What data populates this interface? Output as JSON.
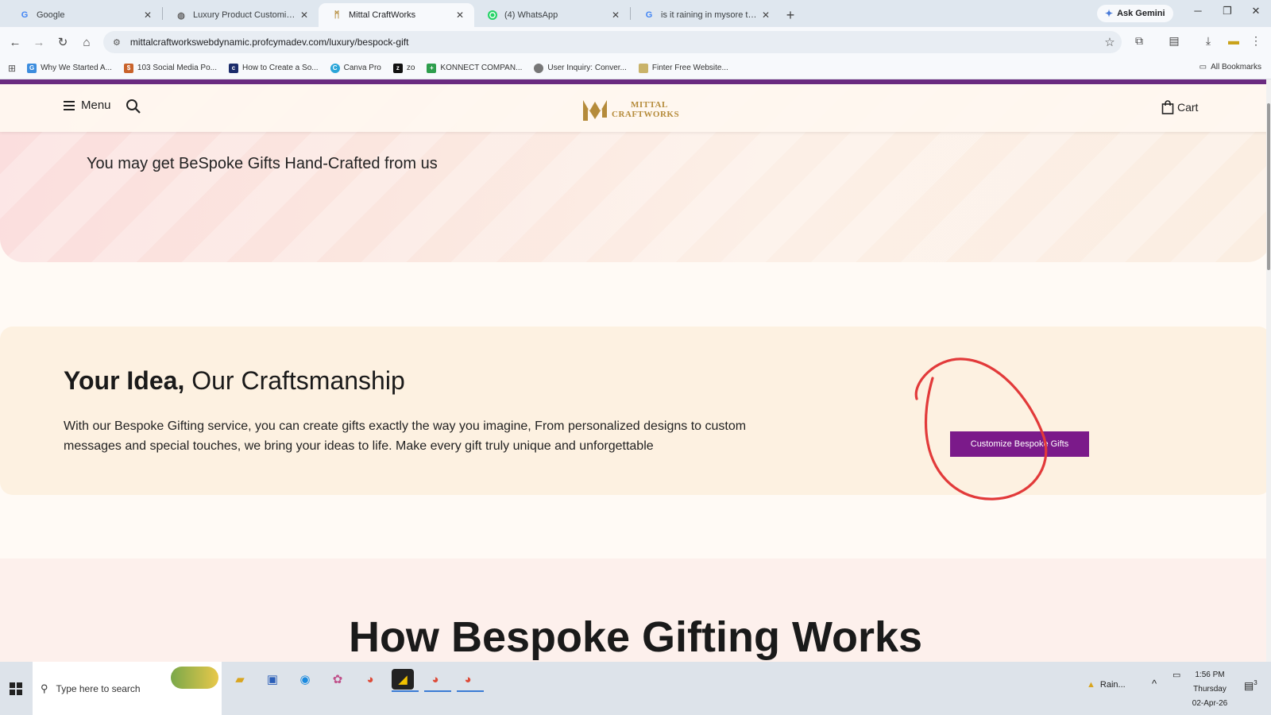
{
  "browser": {
    "tabs": [
      {
        "title": "Google",
        "favicon": "google-icon",
        "active": false
      },
      {
        "title": "Luxury Product Customization",
        "favicon": "globe-icon",
        "active": false
      },
      {
        "title": "Mittal CraftWorks",
        "favicon": "mittal-logo-icon",
        "active": true
      },
      {
        "title": "(4) WhatsApp",
        "favicon": "whatsapp-icon",
        "active": false
      },
      {
        "title": "is it raining in mysore today - G",
        "favicon": "google-icon",
        "active": false
      }
    ],
    "ask_gemini_label": "Ask Gemini",
    "url": "mittalcraftworkswebdynamic.profcymadev.com/luxury/bespock-gift",
    "bookmarks": [
      {
        "label": "Why We Started A...",
        "color": "#3c8dde"
      },
      {
        "label": "103 Social Media Po...",
        "color": "#c9632b"
      },
      {
        "label": "How to Create a So...",
        "color": "#1b2c6b"
      },
      {
        "label": "Canva Pro",
        "color": "#2aa5d8"
      },
      {
        "label": "zo",
        "color": "#111111"
      },
      {
        "label": "KONNECT COMPAN...",
        "color": "#2e9e4d"
      },
      {
        "label": "User Inquiry: Conver...",
        "color": "#777777"
      },
      {
        "label": "Finter Free Website...",
        "color": "#c9b36a"
      }
    ],
    "all_bookmarks_label": "All Bookmarks"
  },
  "site": {
    "menu_label": "Menu",
    "logo_line1": "MITTAL",
    "logo_line2": "CRAFTWORKS",
    "cart_label": "Cart",
    "hero_text": "You may get BeSpoke Gifts Hand-Crafted from us",
    "idea_title_bold": "Your Idea,",
    "idea_title_rest": " Our Craftsmanship",
    "idea_body": "With our Bespoke Gifting service, you can create gifts exactly the way you imagine, From personalized designs to custom messages and special touches, we bring your ideas to life. Make every gift truly unique and unforgettable",
    "cta_label": "Customize Bespoke Gifts",
    "how_title": "How Bespoke Gifting Works",
    "colors": {
      "brand_purple": "#7b1a8a",
      "header_bar": "#6b2a80",
      "logo_gold": "#b58b3a",
      "annotation_red": "#e23a3a"
    }
  },
  "taskbar": {
    "search_placeholder": "Type here to search",
    "weather_label": "Rain...",
    "time": "1:56 PM",
    "day": "Thursday",
    "date": "02-Apr-26",
    "notification_count": "3"
  }
}
